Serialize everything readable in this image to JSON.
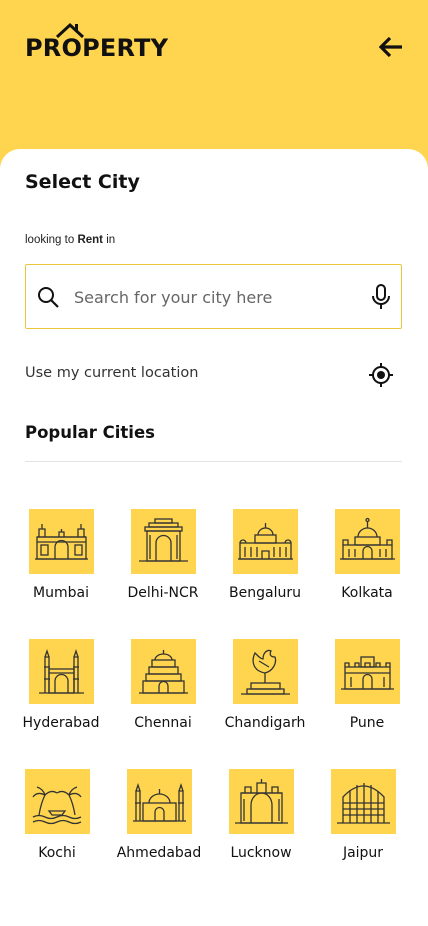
{
  "header": {
    "logo_text": "PROPERTY",
    "back_icon": "arrow-left-icon"
  },
  "sheet": {
    "title": "Select City",
    "looking_prefix": "looking to",
    "looking_mode": "Rent",
    "looking_suffix": "in"
  },
  "search": {
    "placeholder": "Search for your city here",
    "value": "",
    "search_icon": "search-icon",
    "mic_icon": "microphone-icon"
  },
  "location": {
    "label": "Use my current location",
    "icon": "locate-icon"
  },
  "popular": {
    "heading": "Popular Cities",
    "cities": [
      {
        "name": "Mumbai",
        "icon": "gateway-of-india-icon"
      },
      {
        "name": "Delhi-NCR",
        "icon": "india-gate-icon"
      },
      {
        "name": "Bengaluru",
        "icon": "vidhana-soudha-icon"
      },
      {
        "name": "Kolkata",
        "icon": "victoria-memorial-icon"
      },
      {
        "name": "Hyderabad",
        "icon": "charminar-icon"
      },
      {
        "name": "Chennai",
        "icon": "temple-gopuram-icon"
      },
      {
        "name": "Chandigarh",
        "icon": "open-hand-monument-icon"
      },
      {
        "name": "Pune",
        "icon": "shaniwar-wada-icon"
      },
      {
        "name": "Kochi",
        "icon": "palm-beach-icon"
      },
      {
        "name": "Ahmedabad",
        "icon": "mosque-icon"
      },
      {
        "name": "Lucknow",
        "icon": "rumi-darwaza-icon"
      },
      {
        "name": "Jaipur",
        "icon": "hawa-mahal-icon"
      }
    ]
  },
  "colors": {
    "accent": "#ffd54f",
    "search_border": "#e9c63b",
    "divider": "#e4e4e4"
  }
}
